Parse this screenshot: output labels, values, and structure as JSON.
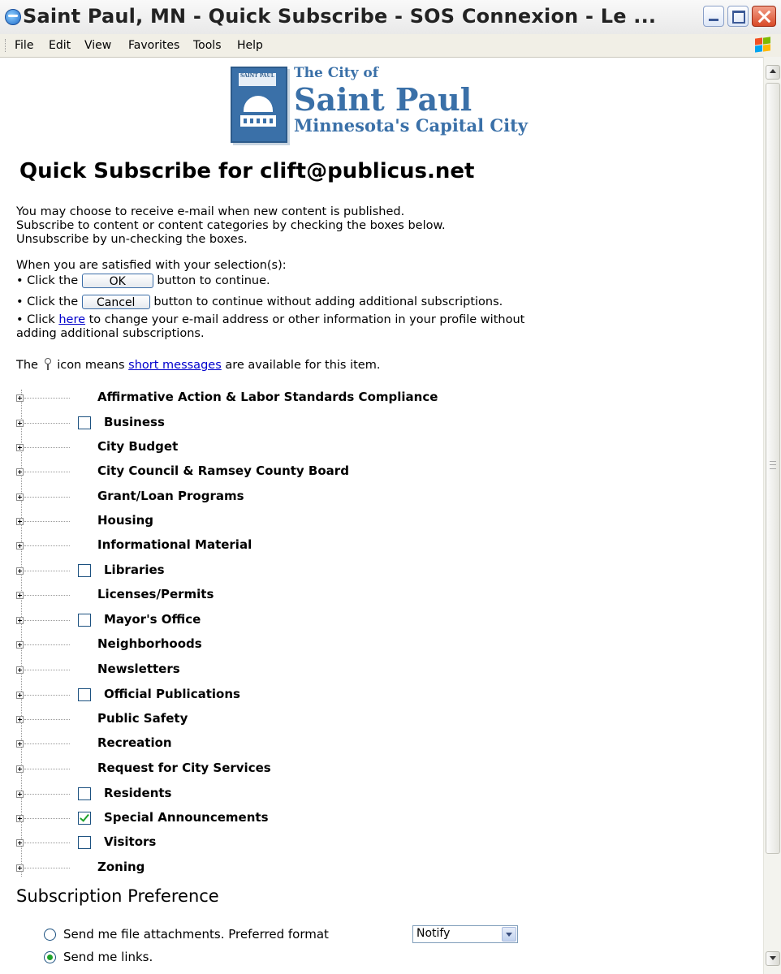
{
  "window": {
    "title": "Saint Paul, MN - Quick Subscribe - SOS Connexion - Le ..."
  },
  "menu": {
    "items": [
      "File",
      "Edit",
      "View",
      "Favorites",
      "Tools",
      "Help"
    ]
  },
  "logo": {
    "seal_text": "SAINT PAUL",
    "line1": "The City of",
    "line2": "Saint Paul",
    "line3": "Minnesota's Capital City"
  },
  "page": {
    "title": "Quick Subscribe for clift@publicus.net",
    "intro": [
      "You may choose to receive e-mail when new content is published.",
      "Subscribe to content or content categories by checking the boxes below.",
      "Unsubscribe by un-checking the boxes."
    ],
    "satisfied": "When you are satisfied with your selection(s):",
    "bullet_ok_pre": "• Click the",
    "ok_button": "OK",
    "bullet_ok_post": "button to continue.",
    "bullet_cancel_pre": "• Click the",
    "cancel_button": "Cancel",
    "bullet_cancel_post": "button to continue without adding additional subscriptions.",
    "bullet_here_pre": "• Click",
    "here_link": "here",
    "bullet_here_post": "to change your e-mail address or other information in your profile without",
    "bullet_here_line2": "adding additional subscriptions.",
    "icon_note_pre": "The",
    "icon_note_mid": "icon means",
    "short_messages_link": "short messages",
    "icon_note_post": "are available for this item."
  },
  "tree": {
    "items": [
      {
        "label": "Affirmative Action & Labor Standards Compliance",
        "checkbox": false,
        "checked": false
      },
      {
        "label": "Business",
        "checkbox": true,
        "checked": false
      },
      {
        "label": "City Budget",
        "checkbox": false,
        "checked": false
      },
      {
        "label": "City Council & Ramsey County Board",
        "checkbox": false,
        "checked": false
      },
      {
        "label": "Grant/Loan Programs",
        "checkbox": false,
        "checked": false
      },
      {
        "label": "Housing",
        "checkbox": false,
        "checked": false
      },
      {
        "label": "Informational Material",
        "checkbox": false,
        "checked": false
      },
      {
        "label": "Libraries",
        "checkbox": true,
        "checked": false
      },
      {
        "label": "Licenses/Permits",
        "checkbox": false,
        "checked": false
      },
      {
        "label": "Mayor's Office",
        "checkbox": true,
        "checked": false
      },
      {
        "label": "Neighborhoods",
        "checkbox": false,
        "checked": false
      },
      {
        "label": "Newsletters",
        "checkbox": false,
        "checked": false
      },
      {
        "label": "Official Publications",
        "checkbox": true,
        "checked": false
      },
      {
        "label": "Public Safety",
        "checkbox": false,
        "checked": false
      },
      {
        "label": "Recreation",
        "checkbox": false,
        "checked": false
      },
      {
        "label": "Request for City Services",
        "checkbox": false,
        "checked": false
      },
      {
        "label": "Residents",
        "checkbox": true,
        "checked": false
      },
      {
        "label": "Special Announcements",
        "checkbox": true,
        "checked": true
      },
      {
        "label": "Visitors",
        "checkbox": true,
        "checked": false
      },
      {
        "label": "Zoning",
        "checkbox": false,
        "checked": false
      }
    ]
  },
  "preference": {
    "title": "Subscription Preference",
    "attachments_label": "Send me file attachments. Preferred format",
    "format_value": "Notify",
    "links_label": "Send me links.",
    "selected": "links"
  }
}
